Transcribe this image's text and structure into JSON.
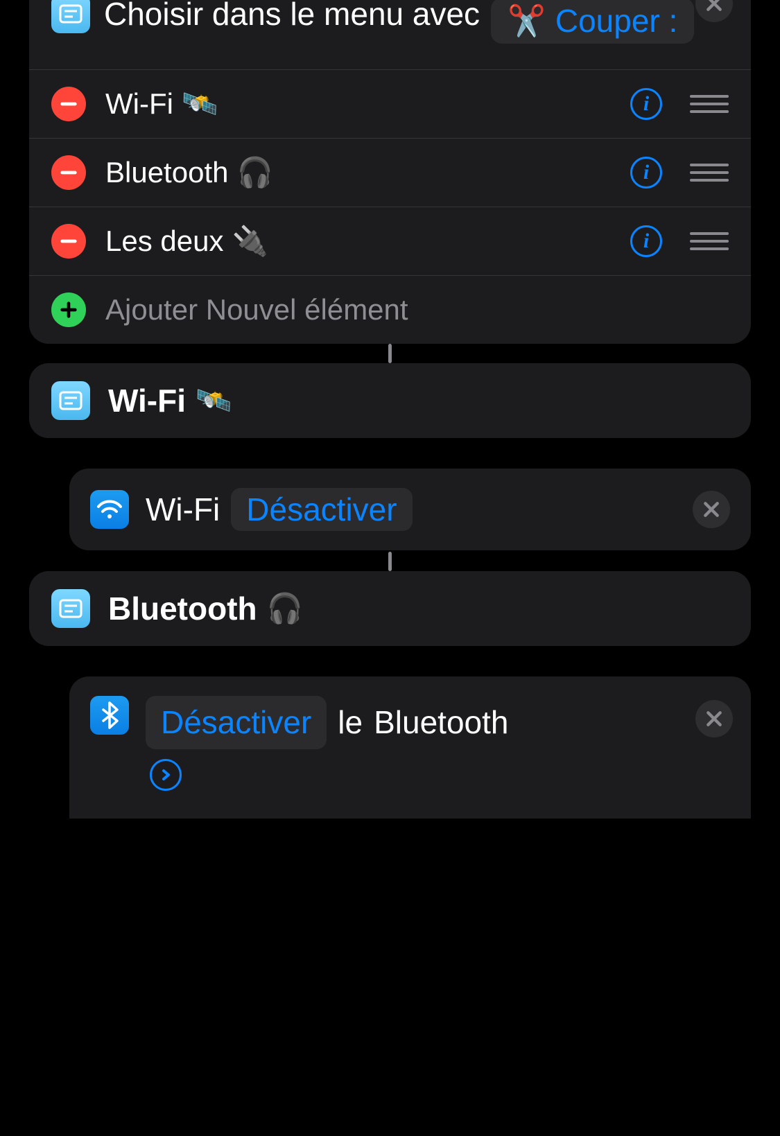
{
  "menu": {
    "title": "Choisir dans le menu avec",
    "scissors_emoji": "✂️",
    "variable": "Couper :",
    "items": [
      {
        "label": "Wi-Fi",
        "emoji": "🛰️"
      },
      {
        "label": "Bluetooth",
        "emoji": "🎧"
      },
      {
        "label": "Les deux",
        "emoji": "🔌"
      }
    ],
    "add_label": "Ajouter Nouvel élément"
  },
  "case_wifi": {
    "label": "Wi-Fi",
    "emoji": "🛰️"
  },
  "action_wifi": {
    "prefix": "Wi-Fi",
    "value": "Désactiver"
  },
  "case_bluetooth": {
    "label": "Bluetooth",
    "emoji": "🎧"
  },
  "action_bluetooth": {
    "value": "Désactiver",
    "mid": "le",
    "suffix": "Bluetooth"
  }
}
